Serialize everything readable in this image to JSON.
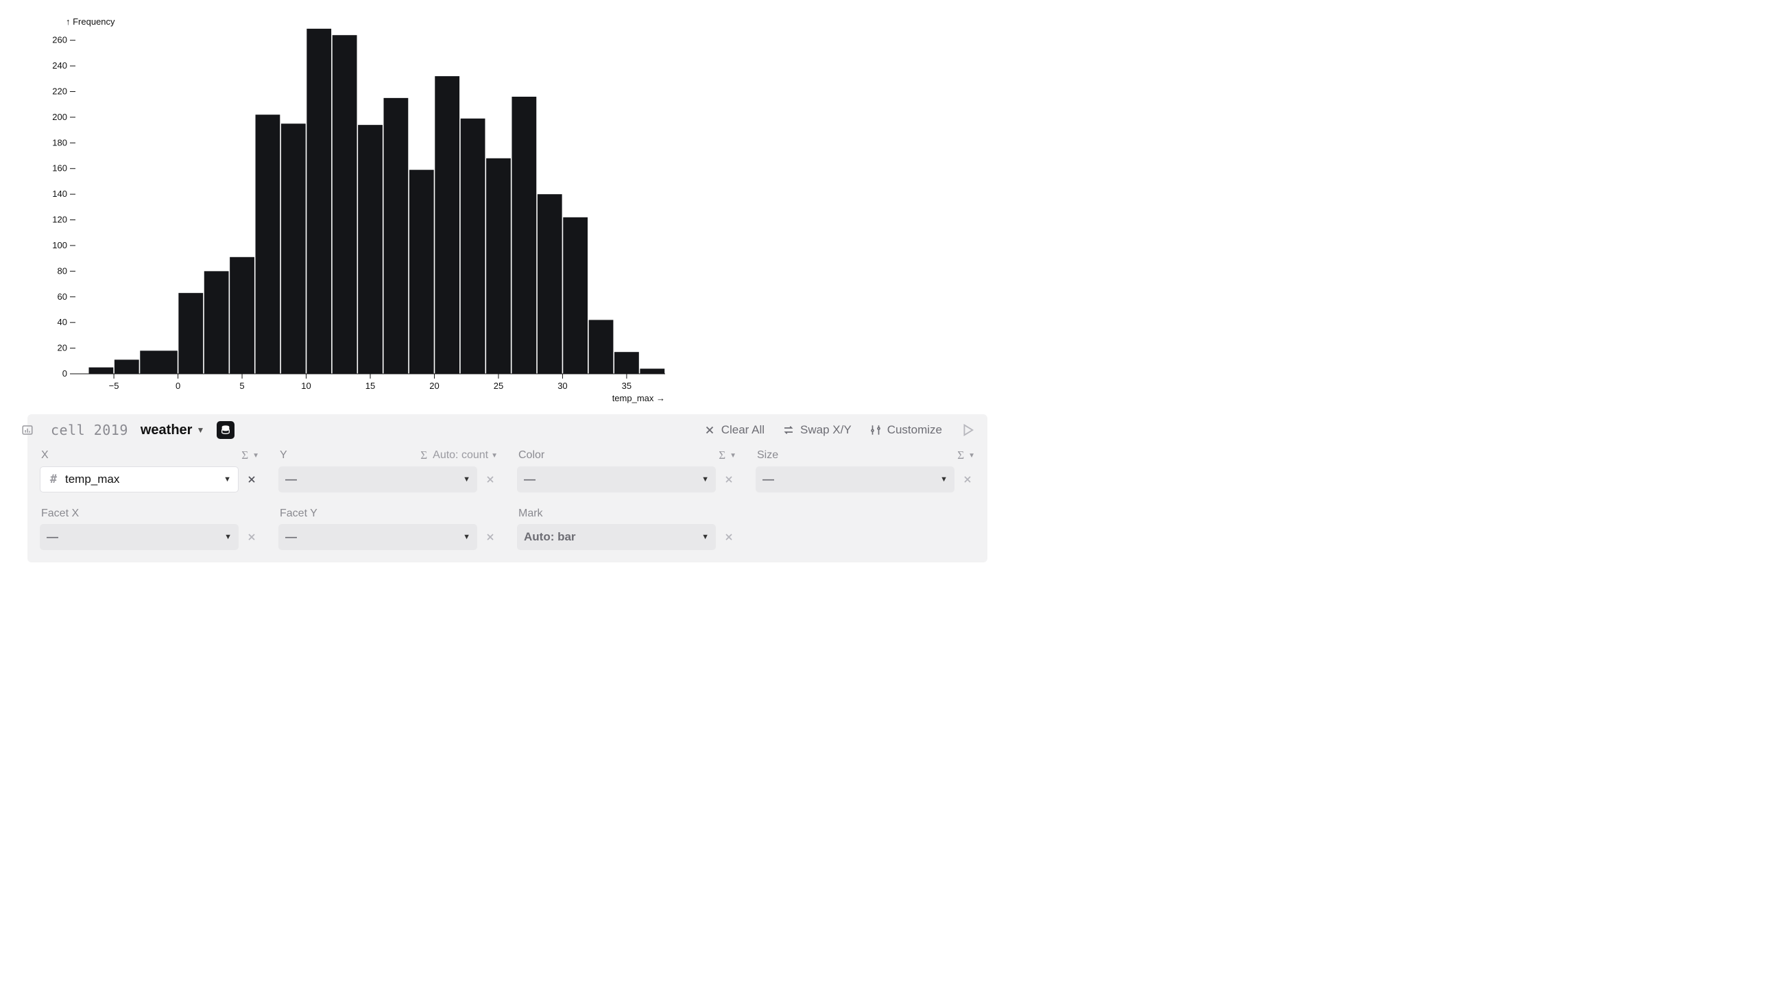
{
  "chart_data": {
    "type": "bar",
    "title": "",
    "xlabel": "temp_max",
    "ylabel": "Frequency",
    "x_ticks": [
      -5,
      0,
      5,
      10,
      15,
      20,
      25,
      30,
      35
    ],
    "y_ticks": [
      0,
      20,
      40,
      60,
      80,
      100,
      120,
      140,
      160,
      180,
      200,
      220,
      240,
      260
    ],
    "xlim": [
      -8,
      38
    ],
    "ylim": [
      0,
      270
    ],
    "bin_starts": [
      -7,
      -6,
      -5,
      -4,
      -3,
      -2,
      -1,
      0,
      1,
      2,
      3,
      4,
      5,
      6,
      7,
      8,
      9,
      10,
      11,
      12,
      13,
      14,
      15,
      16,
      17,
      18,
      19,
      20,
      21,
      22,
      23,
      24,
      25,
      26,
      27,
      28,
      29,
      30,
      31,
      32,
      33,
      34,
      35,
      36,
      37
    ],
    "values": [
      5,
      5,
      11,
      11,
      18,
      18,
      18,
      63,
      63,
      80,
      80,
      91,
      91,
      202,
      202,
      195,
      195,
      269,
      269,
      264,
      264,
      194,
      194,
      215,
      215,
      159,
      159,
      232,
      232,
      199,
      199,
      168,
      168,
      216,
      216,
      140,
      140,
      122,
      122,
      42,
      42,
      17,
      17,
      4,
      4
    ]
  },
  "panel": {
    "cell_name": "cell 2019",
    "dataset": "weather",
    "buttons": {
      "clear_all": "Clear All",
      "swap": "Swap X/Y",
      "customize": "Customize"
    },
    "encodings": {
      "x": {
        "label": "X",
        "value": "temp_max",
        "type_icon": "#",
        "filled": true,
        "has_sigma": true,
        "auto": ""
      },
      "y": {
        "label": "Y",
        "value": "—",
        "filled": false,
        "has_sigma": true,
        "auto": "Auto: count"
      },
      "color": {
        "label": "Color",
        "value": "—",
        "filled": false,
        "has_sigma": true,
        "auto": ""
      },
      "size": {
        "label": "Size",
        "value": "—",
        "filled": false,
        "has_sigma": true,
        "auto": ""
      },
      "facet_x": {
        "label": "Facet X",
        "value": "—",
        "filled": false,
        "has_sigma": false,
        "auto": ""
      },
      "facet_y": {
        "label": "Facet Y",
        "value": "—",
        "filled": false,
        "has_sigma": false,
        "auto": ""
      },
      "mark": {
        "label": "Mark",
        "value": "Auto: bar",
        "filled": false,
        "has_sigma": false,
        "auto": ""
      }
    }
  }
}
